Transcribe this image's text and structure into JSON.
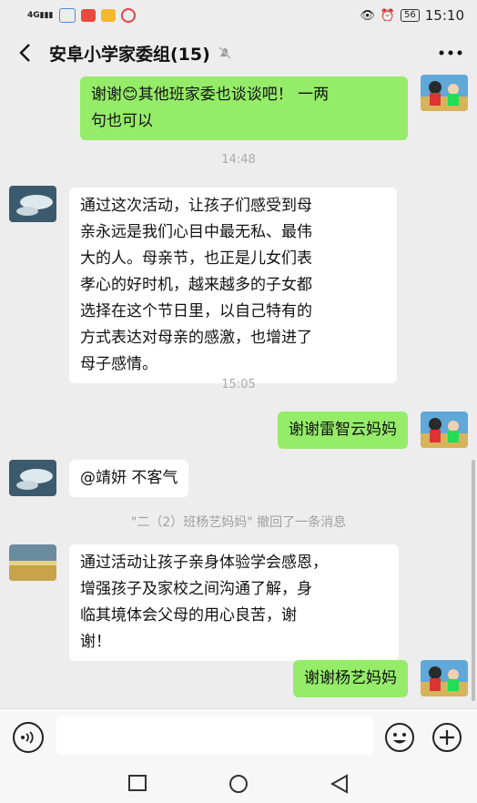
{
  "status_bar": {
    "signal_label": "4G",
    "time": "15:10",
    "battery": "56"
  },
  "header": {
    "title": "安阜小学家委组(15)"
  },
  "messages": [
    {
      "side": "me",
      "text": "谢谢😊其他班家委也谈谈吧！ 一两句也可以"
    },
    {
      "time": "14:48"
    },
    {
      "side": "other",
      "text": "通过这次活动，让孩子们感受到母亲永远是我们心目中最无私、最伟大的人。母亲节，也正是儿女们表孝心的好时机，越来越多的子女都选择在这个节日里，以自己特有的方式表达对母亲的感激，也增进了母子感情。"
    },
    {
      "time": "15:05"
    },
    {
      "side": "me",
      "text": "谢谢雷智云妈妈"
    },
    {
      "side": "other",
      "text": "@靖妍 不客气"
    },
    {
      "system": "\"二（2）班杨艺妈妈\" 撤回了一条消息"
    },
    {
      "side": "other",
      "text": "通过活动让孩子亲身体验学会感恩，增强孩子及家校之间沟通了解，身临其境体会父母的用心良苦，谢谢！"
    },
    {
      "side": "me",
      "text": "谢谢杨艺妈妈"
    }
  ],
  "bubble_lines": {
    "m1_line1": "谢谢😊其他班家委也谈谈吧！ 一两",
    "m1_line2": "句也可以",
    "m2_lines": [
      "通过这次活动，让孩子们感受到母",
      "亲永远是我们心目中最无私、最伟",
      "大的人。母亲节，也正是儿女们表",
      "孝心的好时机，越来越多的子女都",
      "选择在这个节日里，以自己特有的",
      "方式表达对母亲的感激，也增进了",
      "母子感情。"
    ],
    "m3": "谢谢雷智云妈妈",
    "m4": "@靖妍 不客气",
    "m5_lines": [
      "通过活动让孩子亲身体验学会感恩，",
      "增强孩子及家校之间沟通了解，身",
      "临其境体会父母的用心良苦，谢",
      "谢！"
    ],
    "m6": "谢谢杨艺妈妈"
  },
  "times": {
    "t1": "14:48",
    "t2": "15:05"
  },
  "system_notice": "\"二（2）班杨艺妈妈\" 撤回了一条消息",
  "icons": {
    "back": "chevron-left-icon",
    "mute": "bell-off-icon",
    "more": "more-dots-icon",
    "voice": "voice-icon",
    "emoji": "emoji-icon",
    "plus": "plus-icon"
  },
  "colors": {
    "my_bubble": "#95ec69",
    "other_bubble": "#ffffff",
    "background": "#ededed"
  }
}
